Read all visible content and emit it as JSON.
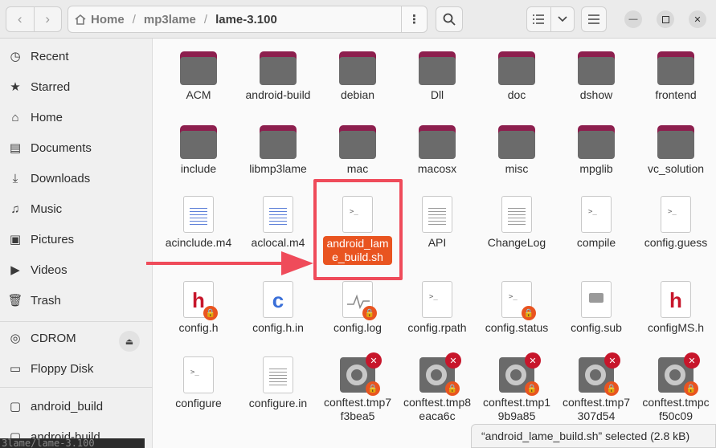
{
  "toolbar": {
    "back_icon": "‹",
    "forward_icon": "›",
    "path": [
      "Home",
      "mp3lame",
      "lame-3.100"
    ],
    "menu_icon": "⋮",
    "search_icon": "search"
  },
  "sidebar": {
    "items": [
      "Recent",
      "Starred",
      "Home",
      "Documents",
      "Downloads",
      "Music",
      "Pictures",
      "Videos",
      "Trash"
    ],
    "devices": [
      "CDROM",
      "Floppy Disk"
    ],
    "bookmarks": [
      "android_build",
      "android-build"
    ]
  },
  "files": [
    {
      "name": "ACM",
      "type": "folder"
    },
    {
      "name": "android-build",
      "type": "folder"
    },
    {
      "name": "debian",
      "type": "folder"
    },
    {
      "name": "Dll",
      "type": "folder"
    },
    {
      "name": "doc",
      "type": "folder"
    },
    {
      "name": "dshow",
      "type": "folder"
    },
    {
      "name": "frontend",
      "type": "folder"
    },
    {
      "name": "include",
      "type": "folder"
    },
    {
      "name": "libmp3lame",
      "type": "folder"
    },
    {
      "name": "mac",
      "type": "folder"
    },
    {
      "name": "macosx",
      "type": "folder"
    },
    {
      "name": "misc",
      "type": "folder"
    },
    {
      "name": "mpglib",
      "type": "folder"
    },
    {
      "name": "vc_solution",
      "type": "folder"
    },
    {
      "name": "acinclude.m4",
      "type": "colored-text"
    },
    {
      "name": "aclocal.m4",
      "type": "colored-text"
    },
    {
      "name": "android_lame_build.sh",
      "type": "script",
      "selected": true
    },
    {
      "name": "API",
      "type": "text"
    },
    {
      "name": "ChangeLog",
      "type": "text"
    },
    {
      "name": "compile",
      "type": "script"
    },
    {
      "name": "config.guess",
      "type": "script"
    },
    {
      "name": "config.h",
      "type": "h",
      "locked": true
    },
    {
      "name": "config.h.in",
      "type": "c"
    },
    {
      "name": "config.log",
      "type": "log",
      "locked": true
    },
    {
      "name": "config.rpath",
      "type": "script"
    },
    {
      "name": "config.status",
      "type": "script",
      "locked": true
    },
    {
      "name": "config.sub",
      "type": "msg"
    },
    {
      "name": "configMS.h",
      "type": "h"
    },
    {
      "name": "configure",
      "type": "script"
    },
    {
      "name": "configure.in",
      "type": "text"
    },
    {
      "name": "conftest.tmp7f3bea5",
      "type": "gear"
    },
    {
      "name": "conftest.tmp8eaca6c",
      "type": "gear"
    },
    {
      "name": "conftest.tmp19b9a85",
      "type": "gear"
    },
    {
      "name": "conftest.tmp7307d54",
      "type": "gear"
    },
    {
      "name": "conftest.tmpcf50c09",
      "type": "gear"
    }
  ],
  "status_text": "“android_lame_build.sh” selected  (2.8 kB)",
  "terminal_ghost": "3lame/lame-3.100",
  "colors": {
    "accent": "#e95420",
    "highlight": "#ef4b5a",
    "folder_tab": "#8d1f4e",
    "folder_body": "#6b6b6b"
  }
}
